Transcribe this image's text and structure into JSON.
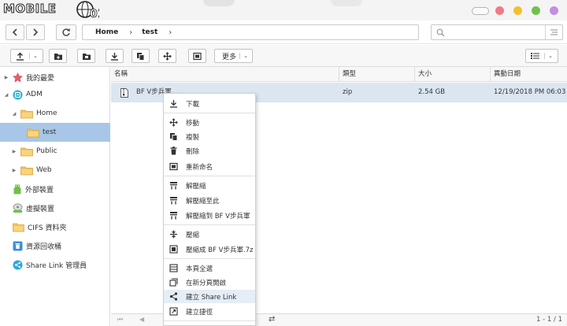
{
  "brand": {
    "logo_text": "MOBILE"
  },
  "nav": {
    "crumbs": [
      "Home",
      "test"
    ],
    "search_placeholder": ""
  },
  "toolbar": {
    "more_label": "更多"
  },
  "sidebar": {
    "items": [
      {
        "label": "我的最愛",
        "icon": "star-icon"
      },
      {
        "label": "ADM",
        "icon": "adm-icon"
      },
      {
        "label": "Home",
        "icon": "folder-icon"
      },
      {
        "label": "test",
        "icon": "folder-icon"
      },
      {
        "label": "Public",
        "icon": "folder-icon"
      },
      {
        "label": "Web",
        "icon": "folder-icon"
      },
      {
        "label": "外部裝置",
        "icon": "usb-icon"
      },
      {
        "label": "虛擬裝置",
        "icon": "virtual-drive-icon"
      },
      {
        "label": "CIFS 資料夾",
        "icon": "folder-icon"
      },
      {
        "label": "資源回收桶",
        "icon": "recycle-bin-icon"
      },
      {
        "label": "Share Link 管理員",
        "icon": "share-icon"
      }
    ]
  },
  "table": {
    "headers": [
      "名稱",
      "類型",
      "大小",
      "異動日期"
    ],
    "rows": [
      {
        "name": "BF V步兵軍...",
        "type": "zip",
        "size": "2.54 GB",
        "date": "12/19/2018 PM 06:03"
      }
    ]
  },
  "context_menu": {
    "items": [
      {
        "label": "下載",
        "icon": "download-icon"
      },
      {
        "label": "移動",
        "icon": "move-icon"
      },
      {
        "label": "複製",
        "icon": "copy-icon"
      },
      {
        "label": "刪除",
        "icon": "trash-icon"
      },
      {
        "label": "重新命名",
        "icon": "rename-icon"
      },
      {
        "label": "解壓縮",
        "icon": "extract-icon"
      },
      {
        "label": "解壓縮至此",
        "icon": "extract-here-icon"
      },
      {
        "label": "解壓縮到 BF V步兵軍",
        "icon": "extract-to-icon"
      },
      {
        "label": "壓縮",
        "icon": "compress-icon"
      },
      {
        "label": "壓縮成 BF V步兵軍.7z",
        "icon": "compress-to-icon"
      },
      {
        "label": "本頁全選",
        "icon": "select-all-icon"
      },
      {
        "label": "在新分頁開啟",
        "icon": "new-tab-icon"
      },
      {
        "label": "建立 Share Link",
        "icon": "share-icon"
      },
      {
        "label": "建立捷徑",
        "icon": "shortcut-icon"
      }
    ]
  },
  "pager": {
    "count_text": "1 - 1 / 1"
  },
  "colors": {
    "selected_row": "#dbe6f1",
    "selected_tree": "#a8c7e8",
    "dot_pink": "#ee7b86",
    "dot_yellow": "#f2c12c",
    "dot_green": "#6fc24a",
    "dot_purple": "#c48de0"
  }
}
